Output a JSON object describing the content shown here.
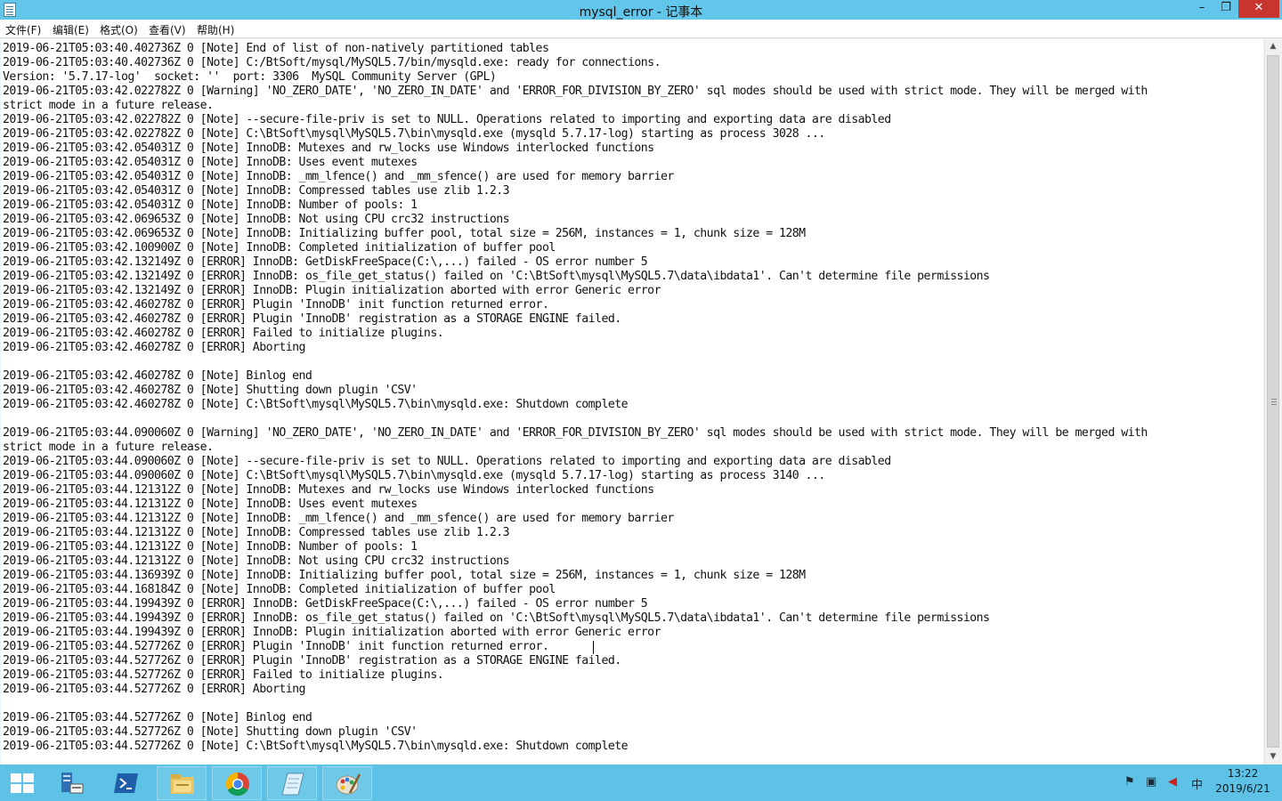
{
  "window": {
    "title": "mysql_error - 记事本"
  },
  "title_buttons": {
    "minimize": "–",
    "maximize": "❐",
    "close": "✕"
  },
  "menu": [
    "文件(F)",
    "编辑(E)",
    "格式(O)",
    "查看(V)",
    "帮助(H)"
  ],
  "lines": [
    "2019-06-21T05:03:40.402736Z 0 [Note] End of list of non-natively partitioned tables",
    "2019-06-21T05:03:40.402736Z 0 [Note] C:/BtSoft/mysql/MySQL5.7/bin/mysqld.exe: ready for connections.",
    "Version: '5.7.17-log'  socket: ''  port: 3306  MySQL Community Server (GPL)",
    "2019-06-21T05:03:42.022782Z 0 [Warning] 'NO_ZERO_DATE', 'NO_ZERO_IN_DATE' and 'ERROR_FOR_DIVISION_BY_ZERO' sql modes should be used with strict mode. They will be merged with",
    "strict mode in a future release.",
    "2019-06-21T05:03:42.022782Z 0 [Note] --secure-file-priv is set to NULL. Operations related to importing and exporting data are disabled",
    "2019-06-21T05:03:42.022782Z 0 [Note] C:\\BtSoft\\mysql\\MySQL5.7\\bin\\mysqld.exe (mysqld 5.7.17-log) starting as process 3028 ...",
    "2019-06-21T05:03:42.054031Z 0 [Note] InnoDB: Mutexes and rw_locks use Windows interlocked functions",
    "2019-06-21T05:03:42.054031Z 0 [Note] InnoDB: Uses event mutexes",
    "2019-06-21T05:03:42.054031Z 0 [Note] InnoDB: _mm_lfence() and _mm_sfence() are used for memory barrier",
    "2019-06-21T05:03:42.054031Z 0 [Note] InnoDB: Compressed tables use zlib 1.2.3",
    "2019-06-21T05:03:42.054031Z 0 [Note] InnoDB: Number of pools: 1",
    "2019-06-21T05:03:42.069653Z 0 [Note] InnoDB: Not using CPU crc32 instructions",
    "2019-06-21T05:03:42.069653Z 0 [Note] InnoDB: Initializing buffer pool, total size = 256M, instances = 1, chunk size = 128M",
    "2019-06-21T05:03:42.100900Z 0 [Note] InnoDB: Completed initialization of buffer pool",
    "2019-06-21T05:03:42.132149Z 0 [ERROR] InnoDB: GetDiskFreeSpace(C:\\,...) failed - OS error number 5",
    "2019-06-21T05:03:42.132149Z 0 [ERROR] InnoDB: os_file_get_status() failed on 'C:\\BtSoft\\mysql\\MySQL5.7\\data\\ibdata1'. Can't determine file permissions",
    "2019-06-21T05:03:42.132149Z 0 [ERROR] InnoDB: Plugin initialization aborted with error Generic error",
    "2019-06-21T05:03:42.460278Z 0 [ERROR] Plugin 'InnoDB' init function returned error.",
    "2019-06-21T05:03:42.460278Z 0 [ERROR] Plugin 'InnoDB' registration as a STORAGE ENGINE failed.",
    "2019-06-21T05:03:42.460278Z 0 [ERROR] Failed to initialize plugins.",
    "2019-06-21T05:03:42.460278Z 0 [ERROR] Aborting",
    "",
    "2019-06-21T05:03:42.460278Z 0 [Note] Binlog end",
    "2019-06-21T05:03:42.460278Z 0 [Note] Shutting down plugin 'CSV'",
    "2019-06-21T05:03:42.460278Z 0 [Note] C:\\BtSoft\\mysql\\MySQL5.7\\bin\\mysqld.exe: Shutdown complete",
    "",
    "2019-06-21T05:03:44.090060Z 0 [Warning] 'NO_ZERO_DATE', 'NO_ZERO_IN_DATE' and 'ERROR_FOR_DIVISION_BY_ZERO' sql modes should be used with strict mode. They will be merged with",
    "strict mode in a future release.",
    "2019-06-21T05:03:44.090060Z 0 [Note] --secure-file-priv is set to NULL. Operations related to importing and exporting data are disabled",
    "2019-06-21T05:03:44.090060Z 0 [Note] C:\\BtSoft\\mysql\\MySQL5.7\\bin\\mysqld.exe (mysqld 5.7.17-log) starting as process 3140 ...",
    "2019-06-21T05:03:44.121312Z 0 [Note] InnoDB: Mutexes and rw_locks use Windows interlocked functions",
    "2019-06-21T05:03:44.121312Z 0 [Note] InnoDB: Uses event mutexes",
    "2019-06-21T05:03:44.121312Z 0 [Note] InnoDB: _mm_lfence() and _mm_sfence() are used for memory barrier",
    "2019-06-21T05:03:44.121312Z 0 [Note] InnoDB: Compressed tables use zlib 1.2.3",
    "2019-06-21T05:03:44.121312Z 0 [Note] InnoDB: Number of pools: 1",
    "2019-06-21T05:03:44.121312Z 0 [Note] InnoDB: Not using CPU crc32 instructions",
    "2019-06-21T05:03:44.136939Z 0 [Note] InnoDB: Initializing buffer pool, total size = 256M, instances = 1, chunk size = 128M",
    "2019-06-21T05:03:44.168184Z 0 [Note] InnoDB: Completed initialization of buffer pool",
    "2019-06-21T05:03:44.199439Z 0 [ERROR] InnoDB: GetDiskFreeSpace(C:\\,...) failed - OS error number 5",
    "2019-06-21T05:03:44.199439Z 0 [ERROR] InnoDB: os_file_get_status() failed on 'C:\\BtSoft\\mysql\\MySQL5.7\\data\\ibdata1'. Can't determine file permissions",
    "2019-06-21T05:03:44.199439Z 0 [ERROR] InnoDB: Plugin initialization aborted with error Generic error",
    "2019-06-21T05:03:44.527726Z 0 [ERROR] Plugin 'InnoDB' init function returned error.",
    "2019-06-21T05:03:44.527726Z 0 [ERROR] Plugin 'InnoDB' registration as a STORAGE ENGINE failed.",
    "2019-06-21T05:03:44.527726Z 0 [ERROR] Failed to initialize plugins.",
    "2019-06-21T05:03:44.527726Z 0 [ERROR] Aborting",
    "",
    "2019-06-21T05:03:44.527726Z 0 [Note] Binlog end",
    "2019-06-21T05:03:44.527726Z 0 [Note] Shutting down plugin 'CSV'",
    "2019-06-21T05:03:44.527726Z 0 [Note] C:\\BtSoft\\mysql\\MySQL5.7\\bin\\mysqld.exe: Shutdown complete"
  ],
  "taskbar": {
    "apps": [
      {
        "name": "server-manager-icon",
        "pinned": false
      },
      {
        "name": "powershell-icon",
        "pinned": false
      },
      {
        "name": "file-explorer-icon",
        "pinned": true
      },
      {
        "name": "chrome-icon",
        "pinned": true
      },
      {
        "name": "notepad-icon",
        "pinned": true
      },
      {
        "name": "paint-icon",
        "pinned": true
      }
    ],
    "tray": {
      "flag": "⚑",
      "network": "▣",
      "volume": "◀",
      "ime": "中"
    },
    "clock": {
      "time": "13:22",
      "date": "2019/6/21"
    }
  }
}
